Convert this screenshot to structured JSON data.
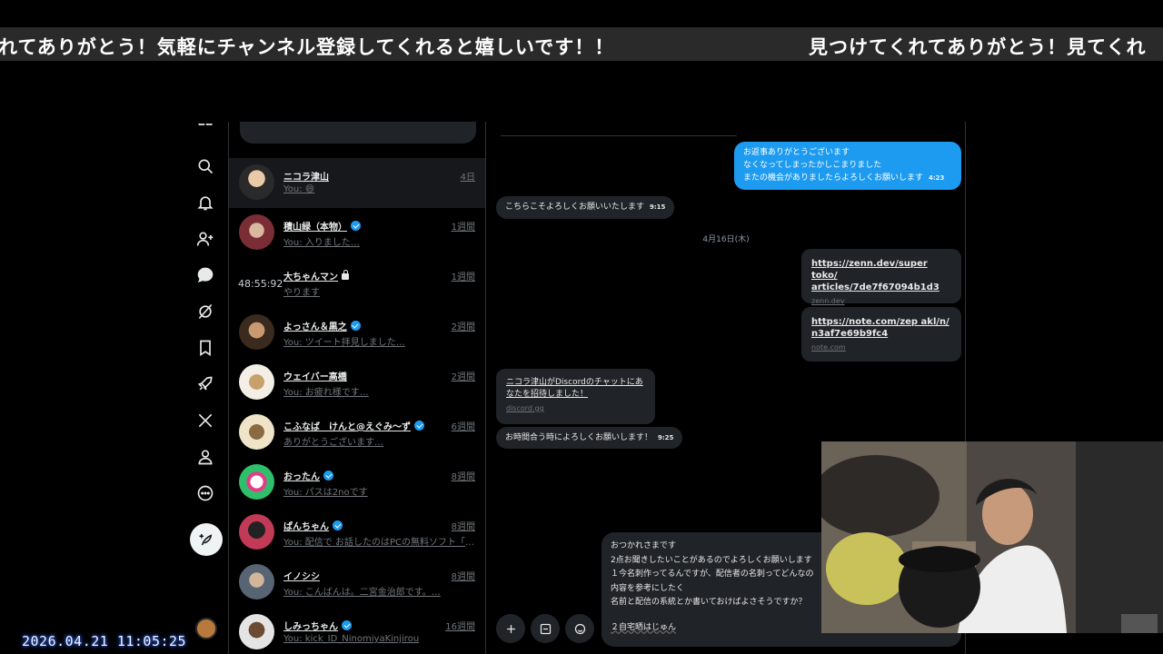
{
  "ticker": {
    "left_text": "れてありがとう！気軽にチャンネル登録してくれると嬉しいです！！",
    "right_text": "見つけてくれてありがとう！見てくれ"
  },
  "nav": {
    "items": [
      "home-icon",
      "search-icon",
      "bell-icon",
      "follow-icon",
      "message-icon",
      "grok-icon",
      "bookmark-icon",
      "rocket-icon",
      "x-icon",
      "profile-icon",
      "more-icon"
    ],
    "compose_icon": "feather-plus-icon"
  },
  "conversations": [
    {
      "name": "ニコラ津山",
      "verified": false,
      "time": "4日",
      "preview": "You: 😄",
      "avatar_color": "#3a3a3a",
      "active": true
    },
    {
      "name": "積山緑（本物）",
      "verified": true,
      "time": "1週間",
      "preview": "You: 入りました…",
      "avatar_color": "#8a3b3b"
    },
    {
      "name": "大ちゃんマン",
      "verified": false,
      "locked": true,
      "time": "1週間",
      "preview": "やります",
      "timer": "48:55:92"
    },
    {
      "name": "よっさん＆黒之",
      "verified": true,
      "time": "2週間",
      "preview": "You: ツイート拝見しました…",
      "avatar_color": "#6b4a2a"
    },
    {
      "name": "ウェイバー高橋",
      "verified": false,
      "time": "2週間",
      "preview": "You: お疲れ様です…",
      "avatar_color": "#d8c6a0"
    },
    {
      "name": "こふなば　けんと@えぐみ～ず",
      "verified": true,
      "time": "6週間",
      "preview": "ありがとうございます…",
      "avatar_color": "#c9b28a"
    },
    {
      "name": "おったん",
      "verified": true,
      "time": "8週間",
      "preview": "You: パスは2noです",
      "avatar_color": "#2fbf6a"
    },
    {
      "name": "ぱんちゃん",
      "verified": true,
      "time": "8週間",
      "preview": "You: 配信で お話したのはPCの無料ソフト「わん…",
      "avatar_color": "#b5304a"
    },
    {
      "name": "イノシシ",
      "verified": false,
      "time": "8週間",
      "preview": "You: こんばんは。二宮金治郎です。…",
      "avatar_color": "#6a7a8a"
    },
    {
      "name": "しみっちゃん",
      "verified": true,
      "time": "16週間",
      "preview": "You: kick_ID_NinomiyaKinjirou",
      "avatar_color": "#d9d9d9"
    }
  ],
  "chat": {
    "out_message_1": {
      "lines": [
        "お返事ありがとうございます",
        "なくなってしまったかしこまりました",
        "またの機会がありましたらよろしくお願いします"
      ],
      "time": "4:23"
    },
    "in_message_1": {
      "text": "こちらこそよろしくお願いいたします",
      "time": "9:15"
    },
    "date_separator": "4月16日(木)",
    "link_card_1": {
      "title_lines": [
        "https://zenn.dev/super toko/",
        "articles/7de7f67094b1d3"
      ],
      "host": "zenn.dev"
    },
    "link_card_2": {
      "title_lines": [
        "https://note.com/zep akl/n/",
        "n3af7e69b9fc4"
      ],
      "host": "note.com"
    },
    "discord_card": {
      "title_lines": [
        "ニコラ津山がDiscordのチャットにあ",
        "なたを招待しました！"
      ],
      "host": "discord.gg"
    },
    "in_message_2": {
      "text": "お時間合う時によろしくお願いします！",
      "time": "9:25"
    }
  },
  "composer": {
    "lines": [
      "おつかれさまです",
      "2点お聞きしたいことがあるのでよろしくお願いします",
      "１今名刺作ってるんですが、配信者の名刺ってどんなの",
      "内容を参考にしたく",
      "名前と配信の系統とか書いておけばよさそうですか？",
      "",
      "２自宅晒はじゅん"
    ],
    "buttons": [
      "plus-icon",
      "gif-icon",
      "emoji-icon"
    ]
  },
  "clock": "2026.04.21  11:05:25"
}
